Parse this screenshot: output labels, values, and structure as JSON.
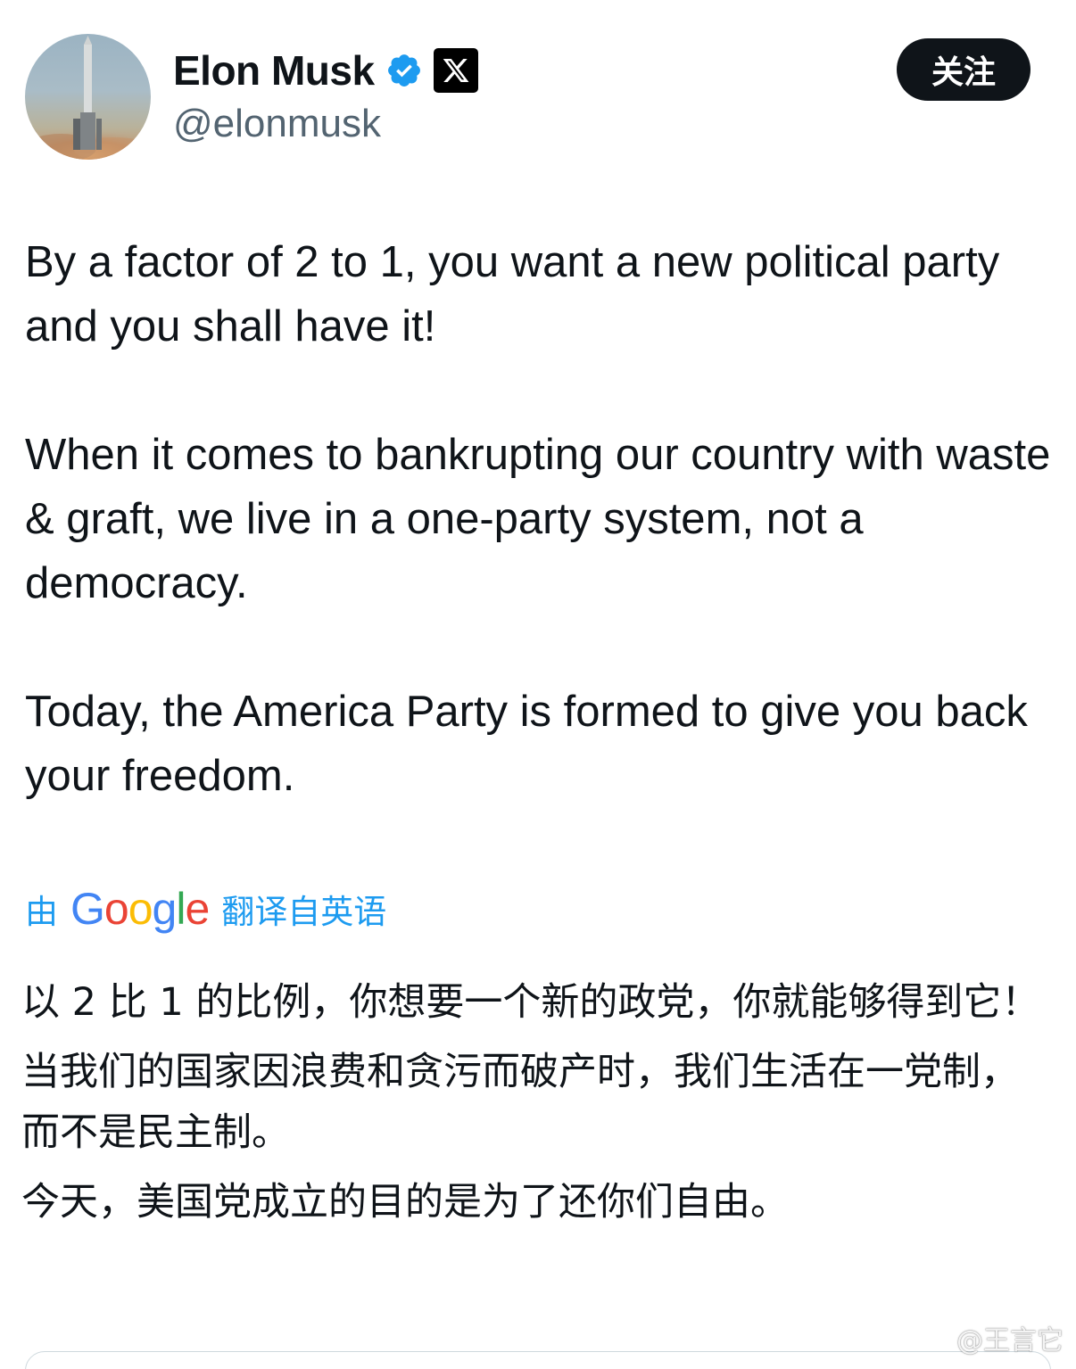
{
  "header": {
    "display_name": "Elon Musk",
    "handle": "@elonmusk",
    "follow_label": "关注"
  },
  "tweet": {
    "paragraphs": [
      "By a factor of 2 to 1, you want a new political party and you shall have it!",
      "When it comes to bankrupting our country with waste & graft, we live in a one-party system, not a democracy.",
      "Today, the America Party is formed to give you back your freedom."
    ]
  },
  "translation": {
    "prefix": "由",
    "provider": "Google",
    "suffix": "翻译自英语",
    "paragraphs": [
      "以 2 比 1 的比例，你想要一个新的政党，你就能够得到它！",
      "当我们的国家因浪费和贪污而破产时，我们生活在一党制，而不是民主制。",
      "今天，美国党成立的目的是为了还你们自由。"
    ]
  },
  "watermark": {
    "text": "@王言它"
  },
  "icons": {
    "verified": "verified-badge-icon",
    "affiliate": "x-logo-icon",
    "watermark": "weibo-icon"
  },
  "colors": {
    "verified_blue": "#1d9bf0",
    "link_blue": "#1d9bf0",
    "text_primary": "#0f1419",
    "text_secondary": "#536471",
    "button_bg": "#0f1419"
  }
}
